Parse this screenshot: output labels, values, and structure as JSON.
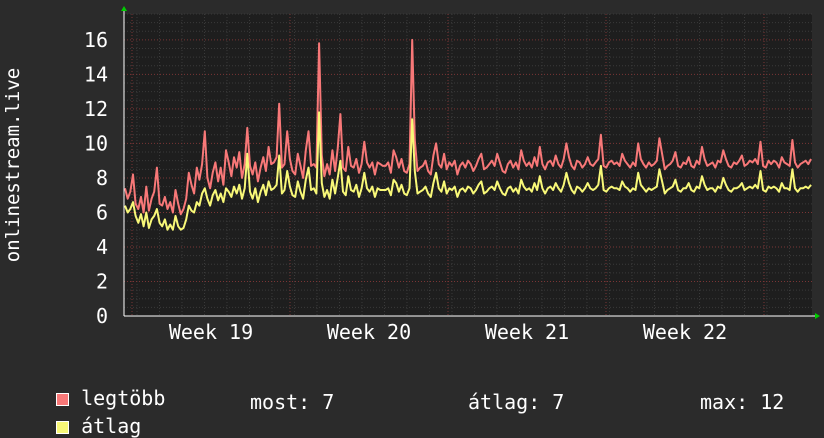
{
  "chart_data": {
    "type": "line",
    "ylabel": "onlinestream.live",
    "ylim": [
      0,
      17.5
    ],
    "yticks": [
      0,
      2,
      4,
      6,
      8,
      10,
      12,
      14,
      16
    ],
    "xticks": [
      "Week 19",
      "Week 20",
      "Week 21",
      "Week 22"
    ],
    "grid": true,
    "legend_placement": "bottom-left",
    "series": [
      {
        "name": "legtöbb",
        "color": "#f87878",
        "values": [
          7.4,
          6.8,
          7.2,
          8.2,
          6.5,
          6.2,
          6.9,
          6.0,
          7.5,
          6.1,
          6.8,
          7.2,
          8.6,
          6.5,
          6.4,
          6.9,
          6.2,
          6.6,
          6.0,
          7.3,
          6.5,
          5.9,
          6.2,
          6.8,
          8.3,
          7.6,
          7.1,
          8.6,
          7.9,
          8.8,
          10.7,
          8.0,
          7.4,
          8.3,
          8.9,
          7.8,
          8.6,
          7.6,
          9.6,
          8.9,
          8.1,
          9.2,
          8.6,
          9.5,
          8.0,
          8.8,
          10.9,
          8.7,
          8.2,
          8.9,
          7.8,
          8.6,
          9.2,
          8.4,
          9.8,
          8.8,
          8.9,
          9.2,
          12.3,
          8.6,
          8.8,
          10.7,
          9.1,
          8.4,
          8.2,
          9.4,
          8.7,
          8.0,
          9.6,
          10.7,
          8.7,
          8.8,
          8.6,
          15.8,
          9.3,
          8.1,
          8.8,
          8.2,
          9.6,
          8.4,
          9.7,
          11.7,
          8.6,
          8.4,
          9.8,
          8.7,
          8.6,
          9.1,
          8.3,
          8.8,
          10.1,
          8.9,
          8.6,
          8.9,
          8.2,
          8.9,
          8.8,
          8.7,
          8.7,
          8.9,
          8.3,
          9.6,
          9.2,
          8.6,
          9.1,
          8.4,
          8.3,
          8.8,
          16.0,
          10.2,
          8.4,
          8.6,
          8.7,
          9.0,
          8.4,
          8.2,
          9.3,
          10.0,
          8.8,
          8.6,
          9.4,
          8.5,
          8.9,
          8.7,
          9.0,
          8.2,
          8.7,
          8.9,
          8.6,
          9.0,
          8.8,
          8.4,
          8.7,
          9.1,
          9.4,
          8.5,
          8.6,
          8.8,
          9.0,
          8.7,
          9.4,
          8.9,
          8.4,
          8.3,
          8.8,
          9.0,
          8.6,
          8.9,
          8.5,
          9.6,
          9.0,
          8.7,
          8.9,
          8.6,
          9.2,
          8.7,
          9.8,
          8.8,
          8.5,
          8.9,
          9.0,
          8.7,
          9.3,
          8.8,
          8.6,
          9.1,
          10.0,
          9.2,
          8.7,
          8.5,
          9.0,
          8.9,
          8.6,
          8.8,
          9.2,
          8.8,
          8.7,
          8.9,
          9.1,
          10.5,
          8.7,
          8.6,
          8.9,
          9.0,
          8.8,
          8.9,
          8.7,
          9.4,
          9.0,
          8.8,
          8.6,
          8.9,
          8.7,
          10.0,
          9.1,
          8.8,
          8.6,
          8.9,
          8.7,
          8.8,
          9.0,
          10.3,
          9.4,
          8.5,
          8.7,
          8.8,
          9.0,
          9.5,
          8.7,
          8.6,
          8.9,
          8.8,
          9.2,
          8.7,
          8.6,
          9.0,
          8.8,
          9.8,
          9.1,
          8.7,
          8.8,
          8.9,
          8.6,
          9.0,
          8.9,
          9.6,
          9.1,
          8.7,
          8.6,
          8.9,
          8.8,
          9.0,
          9.3,
          8.7,
          8.8,
          9.0,
          8.9,
          9.1,
          8.8,
          10.1,
          8.7,
          8.6,
          9.0,
          8.8,
          9.0,
          8.9,
          8.6,
          9.2,
          8.9,
          8.8,
          8.7,
          10.2,
          8.9,
          8.6,
          8.8,
          8.9,
          9.0,
          8.8,
          9.1
        ]
      },
      {
        "name": "átlag",
        "color": "#f8f878",
        "values": [
          6.4,
          6.0,
          6.2,
          6.6,
          5.8,
          5.4,
          5.9,
          5.2,
          6.0,
          5.1,
          5.6,
          5.8,
          6.2,
          5.4,
          5.2,
          5.6,
          5.0,
          5.3,
          5.0,
          5.8,
          5.2,
          5.0,
          5.1,
          5.6,
          6.4,
          6.1,
          6.0,
          6.6,
          6.4,
          7.1,
          7.4,
          6.8,
          6.4,
          7.0,
          7.3,
          6.7,
          7.1,
          6.6,
          7.4,
          7.2,
          6.9,
          7.5,
          7.1,
          7.6,
          6.8,
          7.4,
          9.4,
          7.2,
          6.8,
          7.4,
          6.6,
          7.2,
          7.6,
          7.0,
          7.8,
          7.3,
          7.4,
          7.6,
          9.3,
          7.1,
          7.3,
          8.4,
          7.5,
          7.0,
          6.9,
          7.8,
          7.2,
          6.8,
          7.9,
          8.6,
          7.3,
          7.4,
          7.1,
          11.8,
          7.7,
          6.9,
          7.3,
          6.8,
          7.9,
          7.1,
          8.0,
          9.0,
          7.2,
          7.0,
          8.1,
          7.3,
          7.2,
          7.6,
          6.9,
          7.4,
          8.3,
          7.4,
          7.2,
          7.5,
          6.9,
          7.4,
          7.3,
          7.3,
          7.3,
          7.4,
          7.0,
          7.9,
          7.7,
          7.2,
          7.6,
          7.1,
          7.0,
          7.4,
          11.4,
          8.4,
          7.1,
          7.2,
          7.3,
          7.5,
          7.1,
          6.9,
          7.7,
          8.3,
          7.4,
          7.2,
          7.8,
          7.1,
          7.4,
          7.3,
          7.5,
          6.9,
          7.3,
          7.4,
          7.2,
          7.5,
          7.4,
          7.1,
          7.3,
          7.6,
          7.8,
          7.1,
          7.2,
          7.4,
          7.5,
          7.3,
          7.8,
          7.4,
          7.1,
          7.0,
          7.4,
          7.5,
          7.2,
          7.4,
          7.1,
          7.9,
          7.5,
          7.3,
          7.4,
          7.2,
          7.7,
          7.3,
          8.1,
          7.4,
          7.1,
          7.4,
          7.5,
          7.3,
          7.7,
          7.4,
          7.2,
          7.6,
          8.3,
          7.7,
          7.3,
          7.1,
          7.5,
          7.4,
          7.2,
          7.4,
          7.7,
          7.4,
          7.3,
          7.4,
          7.6,
          8.7,
          7.3,
          7.2,
          7.4,
          7.5,
          7.4,
          7.4,
          7.3,
          7.8,
          7.5,
          7.4,
          7.2,
          7.4,
          7.3,
          8.3,
          7.6,
          7.4,
          7.2,
          7.4,
          7.3,
          7.4,
          7.5,
          8.5,
          7.8,
          7.1,
          7.3,
          7.4,
          7.5,
          7.9,
          7.3,
          7.2,
          7.4,
          7.4,
          7.7,
          7.3,
          7.2,
          7.5,
          7.4,
          8.1,
          7.6,
          7.3,
          7.4,
          7.4,
          7.2,
          7.5,
          7.4,
          8.0,
          7.6,
          7.3,
          7.2,
          7.4,
          7.4,
          7.5,
          7.7,
          7.3,
          7.4,
          7.5,
          7.4,
          7.6,
          7.4,
          8.4,
          7.3,
          7.2,
          7.5,
          7.4,
          7.5,
          7.4,
          7.2,
          7.7,
          7.4,
          7.4,
          7.3,
          8.5,
          7.4,
          7.2,
          7.4,
          7.4,
          7.5,
          7.4,
          7.6
        ]
      }
    ]
  },
  "legend": {
    "items": [
      {
        "label": "legtöbb",
        "color": "#f87878"
      },
      {
        "label": "átlag",
        "color": "#f8f878"
      }
    ]
  },
  "stats": {
    "now": "most: 7",
    "avg": "átlag: 7",
    "max": "max: 12"
  }
}
